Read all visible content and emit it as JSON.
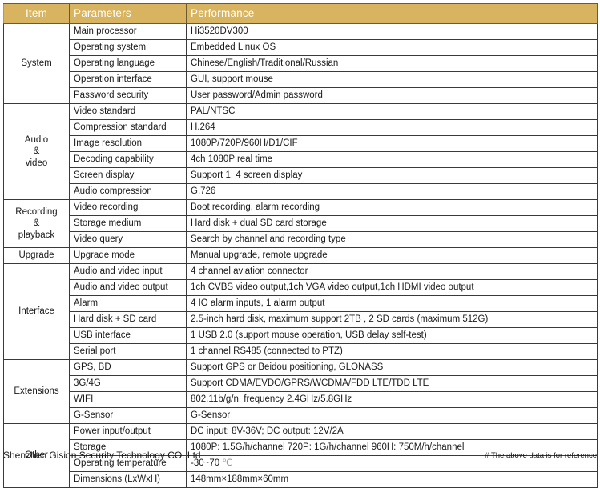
{
  "table": {
    "columns": [
      "Item",
      "Parameters",
      "Performance"
    ],
    "groups": [
      {
        "item": "System",
        "rows": [
          {
            "parameter": "Main processor",
            "performance": "Hi3520DV300"
          },
          {
            "parameter": "Operating system",
            "performance": "Embedded Linux OS"
          },
          {
            "parameter": "Operating language",
            "performance": "Chinese/English/Traditional/Russian"
          },
          {
            "parameter": "Operation interface",
            "performance": "GUI, support mouse"
          },
          {
            "parameter": "Password security",
            "performance": "User password/Admin password"
          }
        ]
      },
      {
        "item": "Audio\n&\nvideo",
        "rows": [
          {
            "parameter": "Video standard",
            "performance": "PAL/NTSC"
          },
          {
            "parameter": "Compression standard",
            "performance": "H.264"
          },
          {
            "parameter": "Image resolution",
            "performance": "1080P/720P/960H/D1/CIF"
          },
          {
            "parameter": "Decoding capability",
            "performance": "4ch 1080P real time"
          },
          {
            "parameter": "Screen display",
            "performance": "Support 1, 4 screen display"
          },
          {
            "parameter": "Audio compression",
            "performance": "G.726"
          }
        ]
      },
      {
        "item": "Recording\n&\nplayback",
        "rows": [
          {
            "parameter": "Video recording",
            "performance": "Boot recording, alarm recording"
          },
          {
            "parameter": "Storage medium",
            "performance": "Hard disk + dual SD card storage"
          },
          {
            "parameter": "Video query",
            "performance": "Search by channel and recording type"
          }
        ]
      },
      {
        "item": "Upgrade",
        "rows": [
          {
            "parameter": "Upgrade mode",
            "performance": "Manual upgrade, remote upgrade"
          }
        ]
      },
      {
        "item": "Interface",
        "rows": [
          {
            "parameter": "Audio and video input",
            "performance": "4 channel aviation connector"
          },
          {
            "parameter": "Audio and video output",
            "performance": "1ch CVBS video output,1ch VGA video output,1ch HDMI video output"
          },
          {
            "parameter": "Alarm",
            "performance": "4 IO alarm inputs, 1 alarm output"
          },
          {
            "parameter": "Hard disk + SD card",
            "performance": "2.5-inch hard disk, maximum support 2TB , 2 SD cards (maximum 512G)"
          },
          {
            "parameter": "USB interface",
            "performance": "1 USB 2.0 (support mouse operation, USB delay self-test)"
          },
          {
            "parameter": "Serial port",
            "performance": "1 channel RS485 (connected to PTZ)"
          }
        ]
      },
      {
        "item": "Extensions",
        "rows": [
          {
            "parameter": "GPS, BD",
            "performance": "Support GPS or Beidou positioning, GLONASS"
          },
          {
            "parameter": "3G/4G",
            "performance": "Support CDMA/EVDO/GPRS/WCDMA/FDD LTE/TDD LTE"
          },
          {
            "parameter": "WIFI",
            "performance": "802.11b/g/n, frequency 2.4GHz/5.8GHz"
          },
          {
            "parameter": "G-Sensor",
            "performance": "G-Sensor"
          }
        ]
      },
      {
        "item": "Other",
        "rows": [
          {
            "parameter": "Power input/output",
            "performance": "DC input: 8V-36V; DC output: 12V/2A"
          },
          {
            "parameter": "Storage",
            "performance": "1080P: 1.5G/h/channel  720P: 1G/h/channel   960H: 750M/h/channel"
          },
          {
            "parameter": "Operating temperature",
            "performance": "-30~70 ℃"
          },
          {
            "parameter": "Dimensions (LxWxH)",
            "performance": "148mm×188mm×60mm"
          }
        ]
      }
    ]
  },
  "footer": {
    "company": "Shenzhen Gision Security Technology CO.,Ltd",
    "disclaimer": "# The above data is for reference"
  },
  "colors": {
    "header_background": "#d8b460",
    "header_text": "#ffffff",
    "border": "#3a3a3a",
    "text": "#1a1a1a"
  }
}
